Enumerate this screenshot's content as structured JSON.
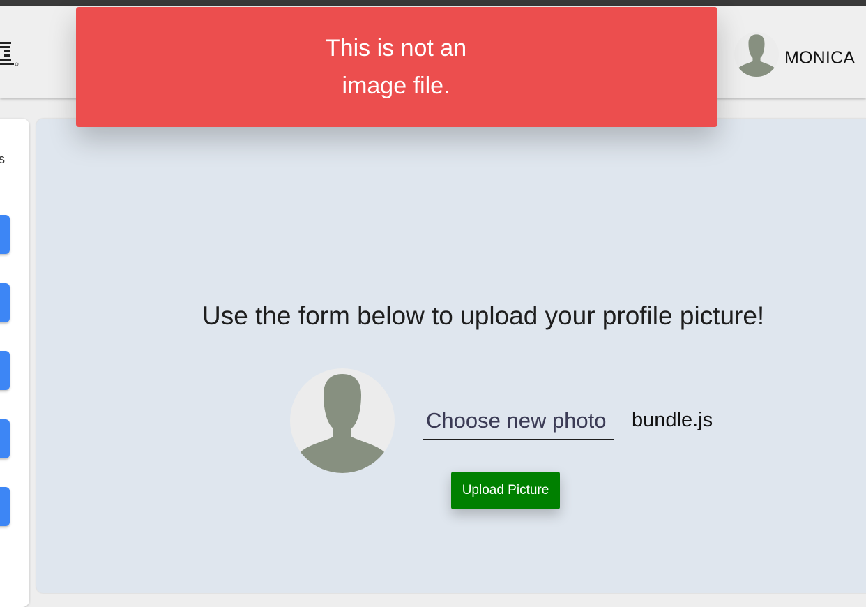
{
  "header": {
    "user": {
      "name": "MONICA",
      "avatar_icon": "person-silhouette-icon"
    },
    "logo_icon": "brand-logo-icon"
  },
  "toast": {
    "line1": "This is not an",
    "line2": "image file.",
    "background": "#ec4e4e"
  },
  "sidebar": {
    "partial_glyph": "s",
    "button_color": "#3d86f5"
  },
  "main": {
    "prompt": "Use the form below to upload your profile picture!",
    "avatar_icon": "person-silhouette-icon",
    "choose_label": "Choose new photo",
    "selected_file": "bundle.js",
    "upload_label": "Upload Picture",
    "upload_color": "#008000",
    "background": "#dfe6ee"
  }
}
